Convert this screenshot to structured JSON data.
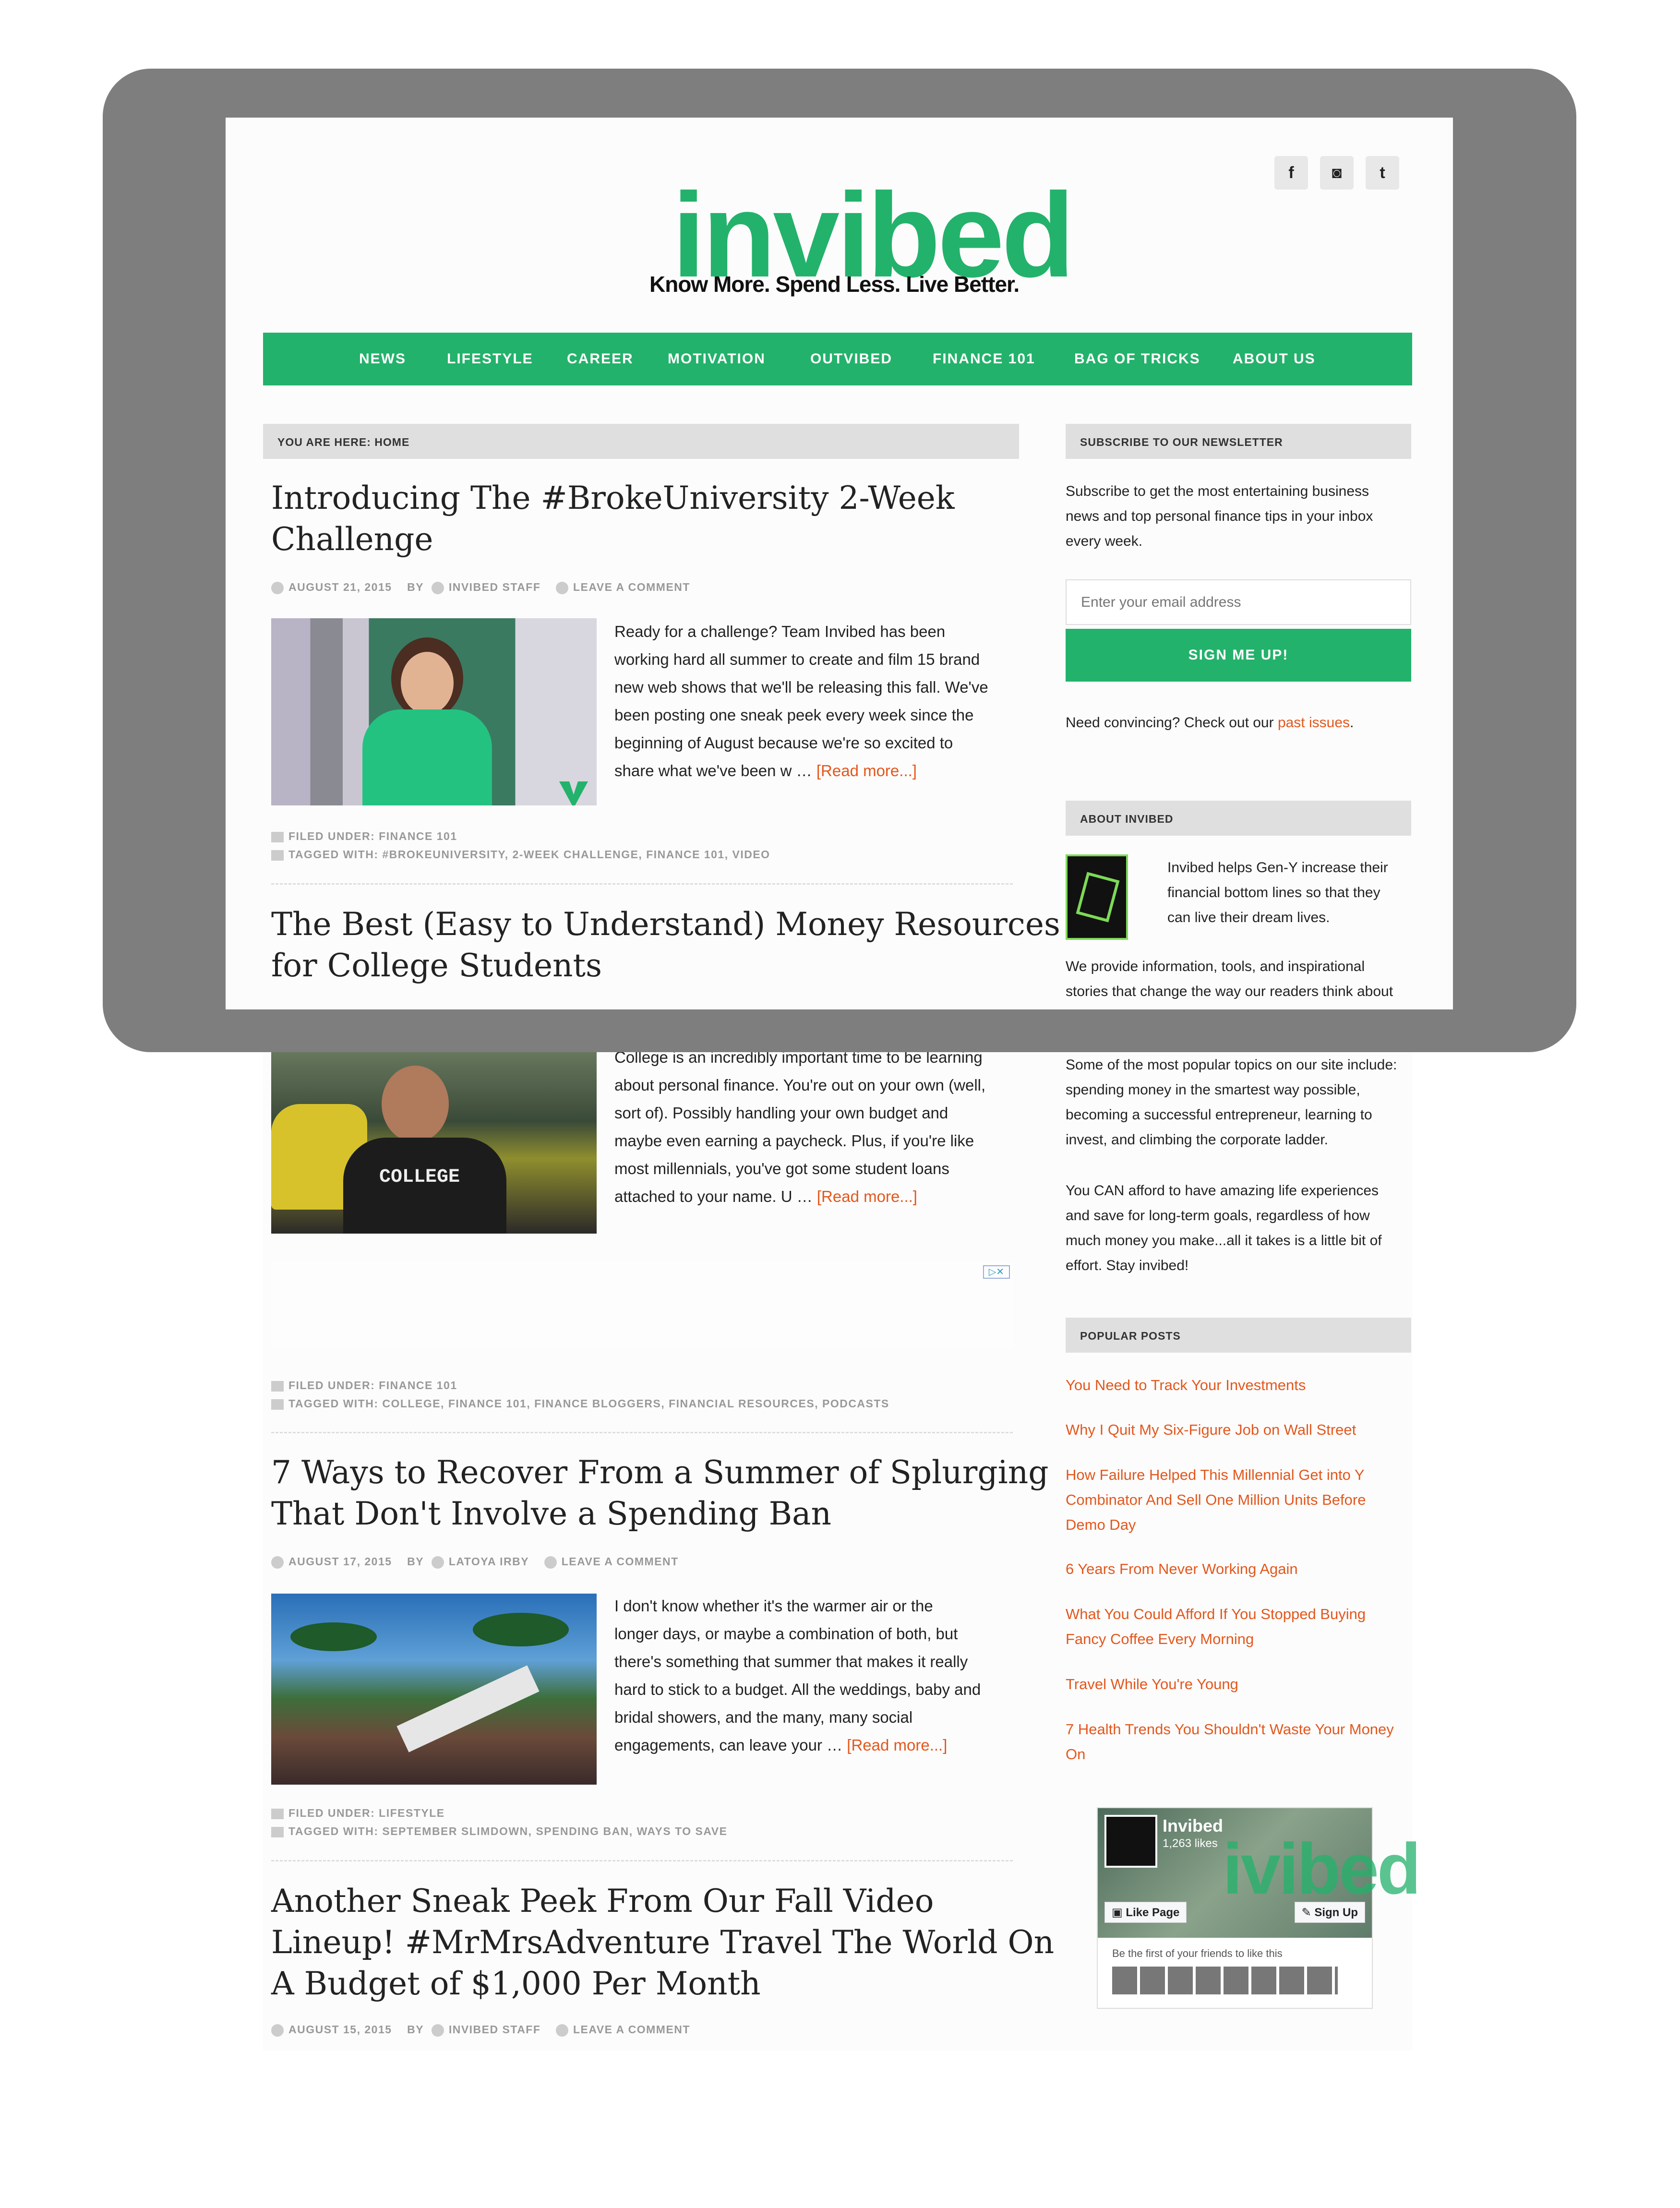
{
  "social": {
    "facebook": "f",
    "instagram": "◙",
    "twitter": "t"
  },
  "brand": {
    "logo": "invibed",
    "tagline": "Know More. Spend Less. Live Better."
  },
  "nav": [
    "NEWS",
    "LIFESTYLE",
    "CAREER",
    "MOTIVATION",
    "OUTVIBED",
    "FINANCE 101",
    "BAG OF TRICKS",
    "ABOUT US"
  ],
  "breadcrumb": "YOU ARE HERE: HOME",
  "posts": [
    {
      "title1": "Introducing The #BrokeUniversity 2-Week",
      "title2": "Challenge",
      "date": "AUGUST 21, 2015",
      "by": "BY",
      "author": "INVIBED STAFF",
      "comment": "LEAVE A COMMENT",
      "lines": [
        "Ready for a challenge? Team Invibed has been",
        "working hard all summer to create and film 15 brand",
        "new web shows that we'll be releasing this fall. We've",
        "been posting one sneak peek every week since the",
        "beginning of August because we're so excited to",
        "share what we've been w … "
      ],
      "read": "[Read more...]",
      "filed": "FILED UNDER: FINANCE 101",
      "tagged": "TAGGED WITH: #BROKEUNIVERSITY, 2-WEEK CHALLENGE, FINANCE 101, VIDEO"
    },
    {
      "title1": "The Best (Easy to Understand) Money Resources",
      "title2": "for College Students",
      "lines": [
        "College is an incredibly important time to be learning",
        "about personal finance. You're out on your own (well,",
        "sort of). Possibly handling your own budget and",
        "maybe even earning a paycheck. Plus, if you're like",
        "most millennials, you've got some student loans",
        "attached to your name. U … "
      ],
      "read": "[Read more...]",
      "shirt": "COLLEGE",
      "filed": "FILED UNDER: FINANCE 101",
      "tagged": "TAGGED WITH: COLLEGE, FINANCE 101, FINANCE BLOGGERS, FINANCIAL RESOURCES, PODCASTS"
    },
    {
      "title1": "7 Ways to Recover From a Summer of Splurging",
      "title2": "That Don't Involve a Spending Ban",
      "date": "AUGUST 17, 2015",
      "by": "BY",
      "author": "LATOYA IRBY",
      "comment": "LEAVE A COMMENT",
      "lines": [
        " I don't know whether it's the warmer air or the",
        "longer days, or maybe a combination of both, but",
        "there's something that summer that makes it really",
        "hard to stick to a budget. All the weddings, baby and",
        "bridal showers, and the many, many social",
        "engagements, can leave your … "
      ],
      "read": "[Read more...]",
      "filed": "FILED UNDER: LIFESTYLE",
      "tagged": "TAGGED WITH: SEPTEMBER SLIMDOWN, SPENDING BAN, WAYS TO SAVE"
    },
    {
      "title1": "Another Sneak Peek From Our Fall Video",
      "title2": "Lineup! #MrMrsAdventure Travel The World On",
      "title3": "A Budget of $1,000 Per Month",
      "date": "AUGUST 15, 2015",
      "by": "BY",
      "author": "INVIBED STAFF",
      "comment": "LEAVE A COMMENT"
    }
  ],
  "newsletter": {
    "head": "SUBSCRIBE TO OUR NEWSLETTER",
    "lines": [
      "Subscribe to get the most entertaining business",
      "news and top personal finance tips in your inbox",
      "every week."
    ],
    "placeholder": "Enter your email address",
    "button": "SIGN ME UP!",
    "convince": "Need convincing? Check out our ",
    "past": "past issues",
    "dot": "."
  },
  "about": {
    "head": "ABOUT INVIBED",
    "lines": [
      "Invibed helps Gen-Y increase their",
      "financial bottom lines so that they",
      "can live their dream lives."
    ],
    "p1": [
      "We provide information, tools, and inspirational",
      "stories that change the way our readers think about"
    ],
    "p2": [
      "Some of the most popular topics on our site include:",
      "spending money in the smartest way possible,",
      "becoming a successful entrepreneur, learning to",
      "invest, and climbing the corporate ladder."
    ],
    "p3": [
      "You CAN afford to have amazing life experiences",
      "and save for long-term goals, regardless of how",
      "much money you make...all it takes is a little bit of",
      "effort. Stay invibed!"
    ]
  },
  "popular": {
    "head": "POPULAR POSTS",
    "items": [
      [
        "You Need to Track Your Investments"
      ],
      [
        "Why I Quit My Six-Figure Job on Wall Street"
      ],
      [
        "How Failure Helped This Millennial Get into Y",
        "Combinator And Sell One Million Units Before",
        "Demo Day"
      ],
      [
        "6 Years From Never Working Again"
      ],
      [
        "What You Could Afford If You Stopped Buying",
        "Fancy Coffee Every Morning"
      ],
      [
        "Travel While You're Young"
      ],
      [
        "7 Health Trends You Shouldn't Waste Your Money",
        "On"
      ]
    ]
  },
  "fb": {
    "name": "Invibed",
    "likes": "1,263 likes",
    "bg": "ivibed",
    "like": "Like Page",
    "signup": "Sign Up",
    "first": "Be the first of your friends to like this"
  },
  "colors": {
    "brand": "#23b26b",
    "link": "#e3571d",
    "frame": "#7e7e7e"
  }
}
